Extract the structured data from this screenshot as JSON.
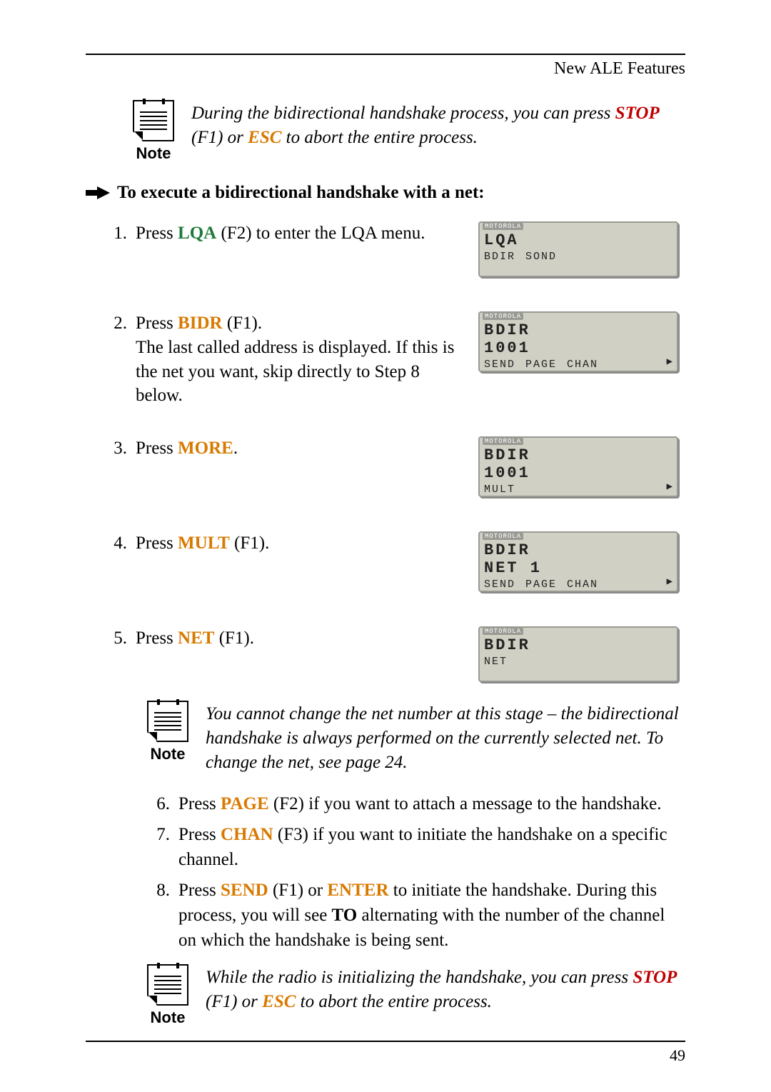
{
  "header": {
    "title": "New ALE Features"
  },
  "noteLabel": "Note",
  "note1": {
    "pre": "During the bidirectional handshake process, you can press ",
    "stop": "STOP",
    "mid": " (F1) or ",
    "esc": "ESC",
    "post": " to abort the entire process."
  },
  "section": {
    "title": "To execute a bidirectional handshake with a net:"
  },
  "steps": {
    "s1": {
      "num": "1.",
      "pre": "Press ",
      "kw": "LQA",
      "post": " (F2) to enter the LQA menu."
    },
    "s2": {
      "num": "2.",
      "pre": "Press ",
      "kw": "BIDR",
      "post1": " (F1).",
      "body": "The last called address is displayed. If this is the net you want, skip directly to Step 8 below."
    },
    "s3": {
      "num": "3.",
      "pre": "Press ",
      "kw": "MORE",
      "post": "."
    },
    "s4": {
      "num": "4.",
      "pre": "Press ",
      "kw": "MULT",
      "post": " (F1)."
    },
    "s5": {
      "num": "5.",
      "pre": "Press ",
      "kw": "NET",
      "post": " (F1)."
    }
  },
  "lcd": {
    "brand": "MOTOROLA",
    "d1": {
      "l1": "LQA",
      "l2": "",
      "sk": [
        "BDIR",
        "SOND"
      ],
      "caret": false
    },
    "d2": {
      "l1": "BDIR",
      "l2": "1001",
      "sk": [
        "SEND",
        "PAGE",
        "CHAN"
      ],
      "caret": true
    },
    "d3": {
      "l1": "BDIR",
      "l2": "1001",
      "sk": [
        "MULT"
      ],
      "caret": true
    },
    "d4": {
      "l1": "BDIR",
      "l2": "NET  1",
      "sk": [
        "SEND",
        "PAGE",
        "CHAN"
      ],
      "caret": true
    },
    "d5": {
      "l1": "BDIR",
      "l2": "",
      "sk": [
        "NET"
      ],
      "caret": false
    }
  },
  "note2": {
    "text": "You cannot change the net number at this stage – the bidirectional handshake is always performed on the currently selected net. To change the net, see page 24."
  },
  "lower": {
    "s6": {
      "num": "6.",
      "pre": "Press ",
      "kw": "PAGE",
      "post": " (F2) if you want to attach a message to the handshake."
    },
    "s7": {
      "num": "7.",
      "pre": "Press ",
      "kw": "CHAN",
      "post": " (F3) if you want to initiate the handshake on a specific channel."
    },
    "s8": {
      "num": "8.",
      "pre": "Press ",
      "kw1": "SEND",
      "mid1": " (F1) or ",
      "kw2": "ENTER",
      "mid2": " to initiate the handshake. During this process, you will see ",
      "to": "TO",
      "post": " alternating with the number of the channel on which the handshake is being sent."
    }
  },
  "note3": {
    "pre": "While the radio is initializing the handshake, you can press ",
    "stop": "STOP",
    "mid": " (F1) or ",
    "esc": "ESC",
    "post": " to abort the entire process."
  },
  "pageNumber": "49"
}
